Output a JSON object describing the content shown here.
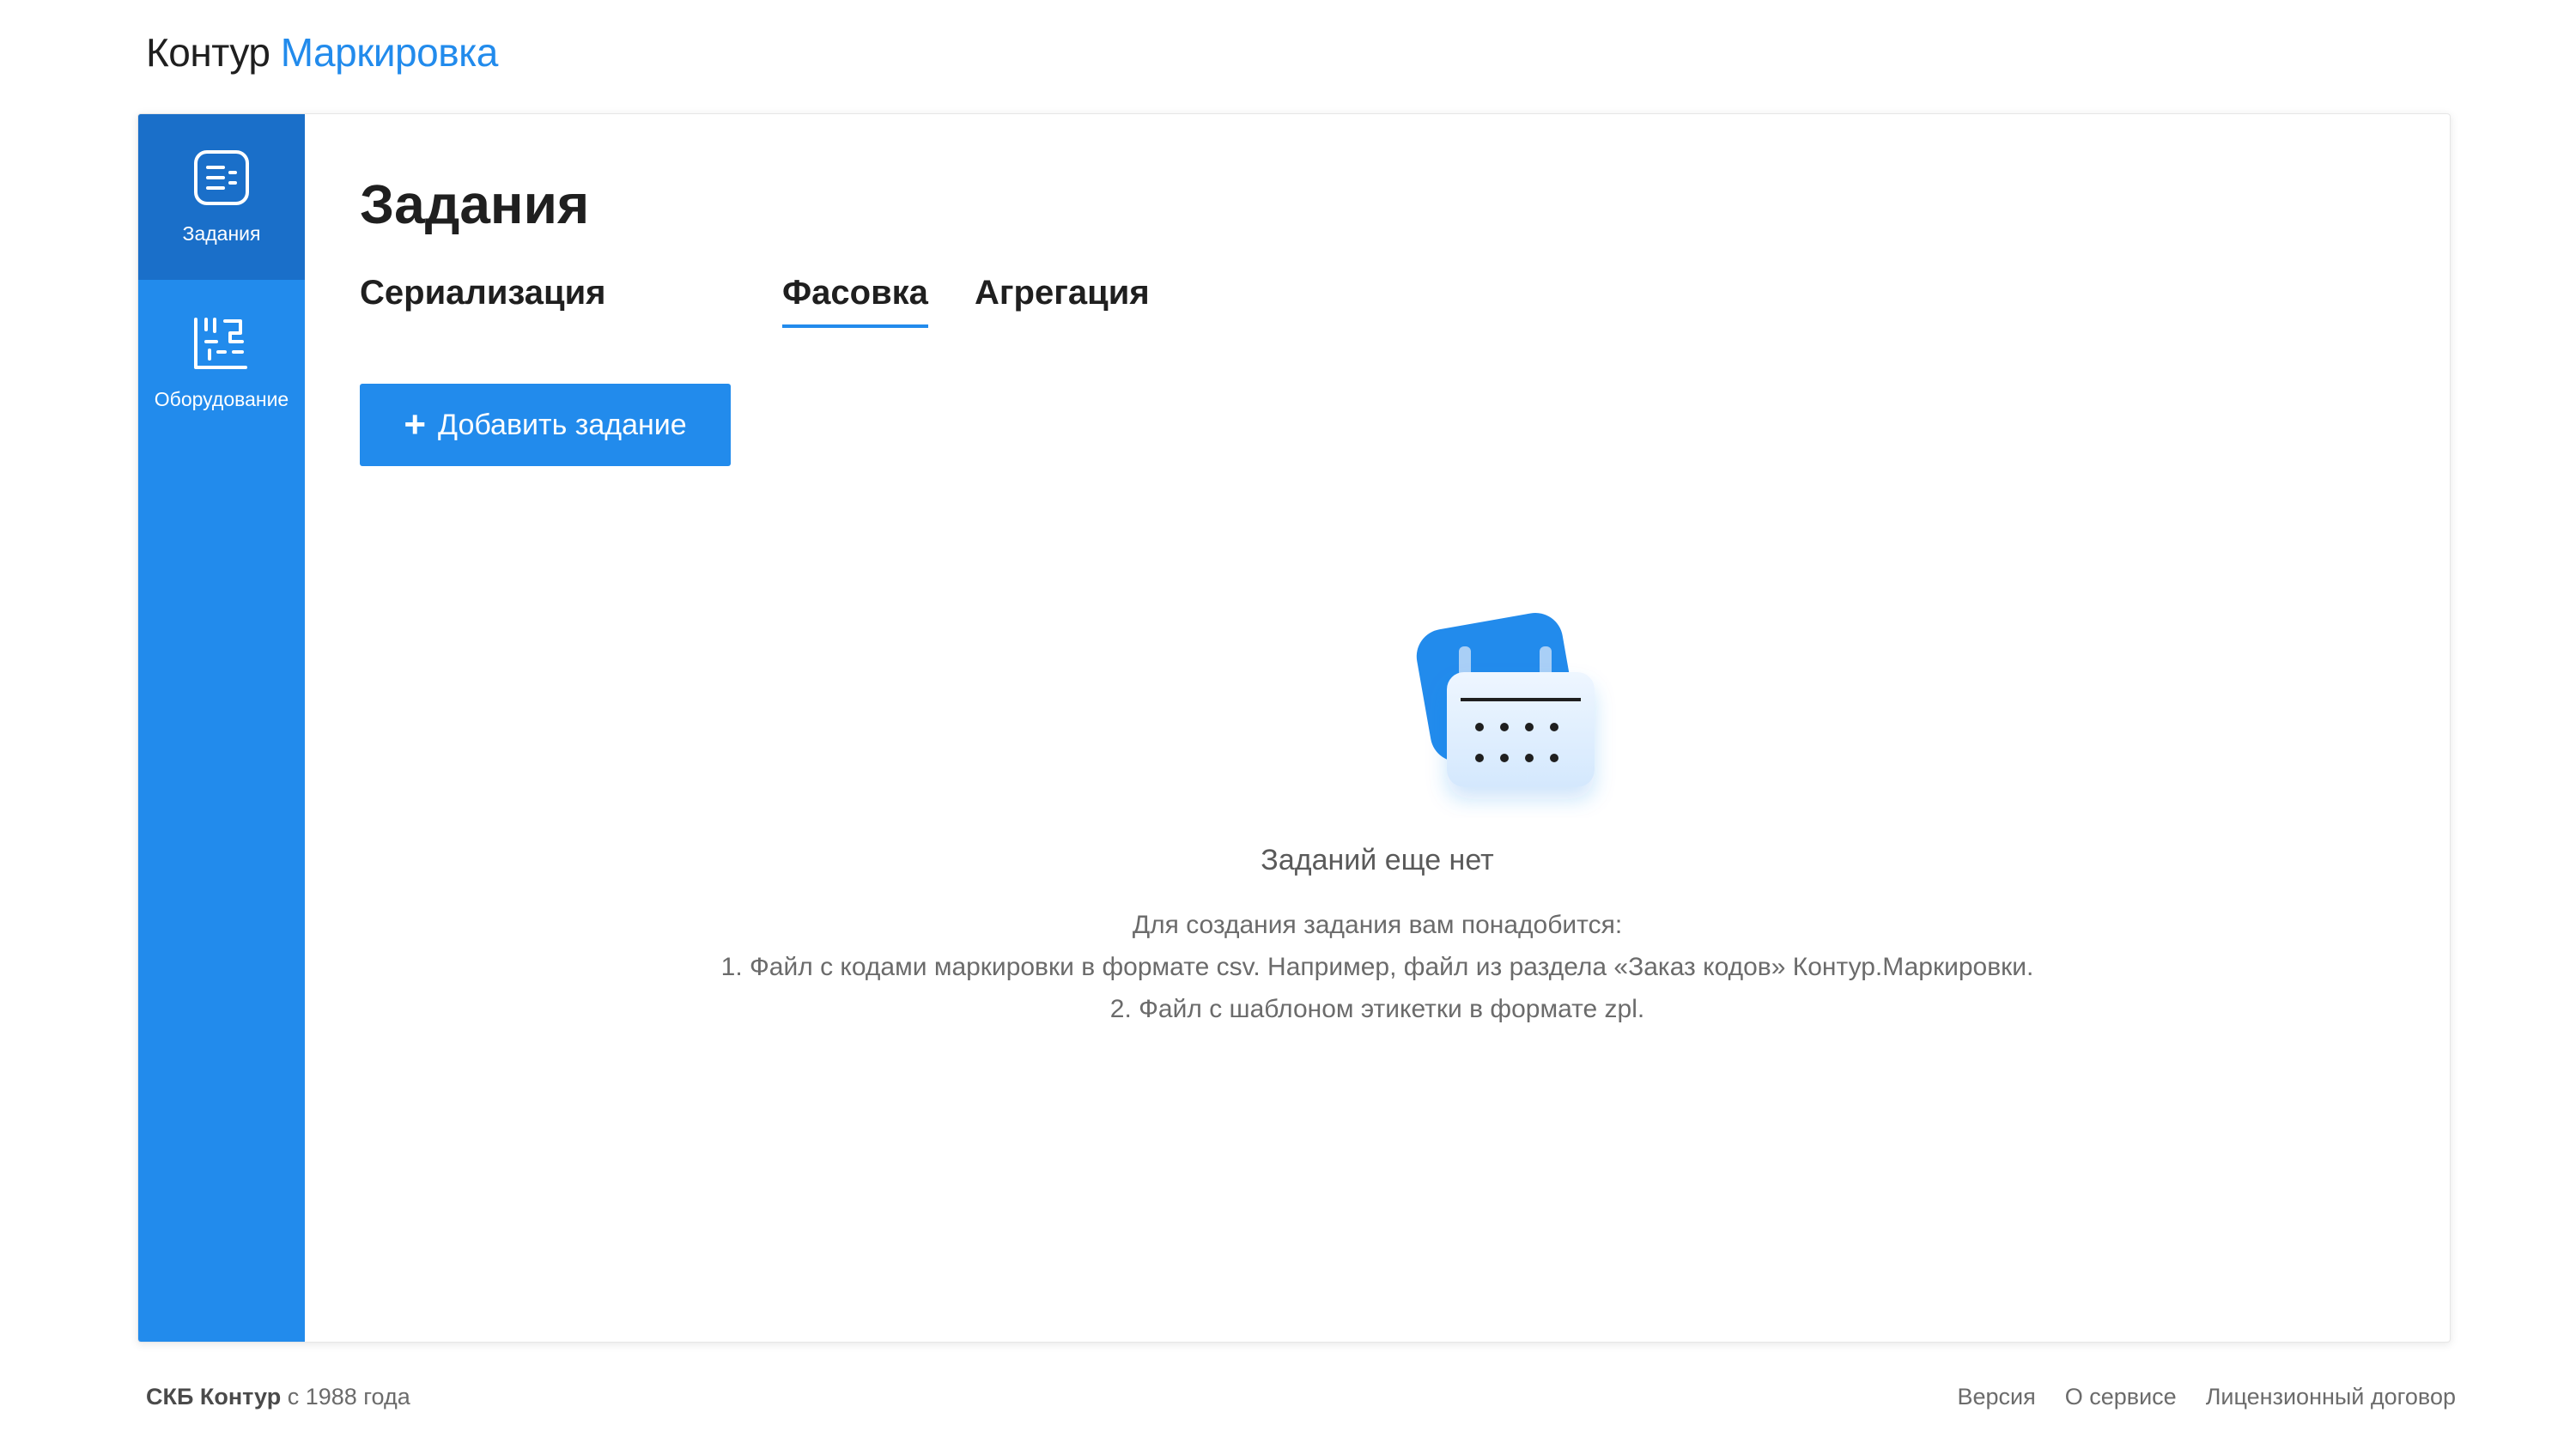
{
  "header": {
    "brand": "Контур",
    "product": "Маркировка"
  },
  "sidebar": {
    "items": [
      {
        "label": "Задания",
        "icon": "tasks-list-icon",
        "active": true
      },
      {
        "label": "Оборудование",
        "icon": "equipment-barcode-icon",
        "active": false
      }
    ]
  },
  "main": {
    "title": "Задания",
    "tabs": [
      {
        "label": "Сериализация",
        "active": false
      },
      {
        "label": "Фасовка",
        "active": true
      },
      {
        "label": "Агрегация",
        "active": false
      }
    ],
    "add_button": {
      "icon": "plus-icon",
      "label": "Добавить задание"
    },
    "empty_state": {
      "image": "calendar-illustration",
      "title": "Заданий еще нет",
      "description_lines": [
        "Для создания задания вам понадобится:",
        "1. Файл с кодами маркировки в формате csv. Например, файл из раздела «Заказ кодов» Контур.Маркировки.",
        "2. Файл с шаблоном этикетки в формате zpl."
      ]
    }
  },
  "footer": {
    "company": "СКБ Контур",
    "since": "с 1988 года",
    "links": [
      "Версия",
      "О сервисе",
      "Лицензионный договор"
    ]
  },
  "colors": {
    "accent": "#228bec",
    "sidebar_active": "#1a6fc9",
    "text_dark": "#1f1f1f",
    "text_muted": "#6b6b6b"
  }
}
